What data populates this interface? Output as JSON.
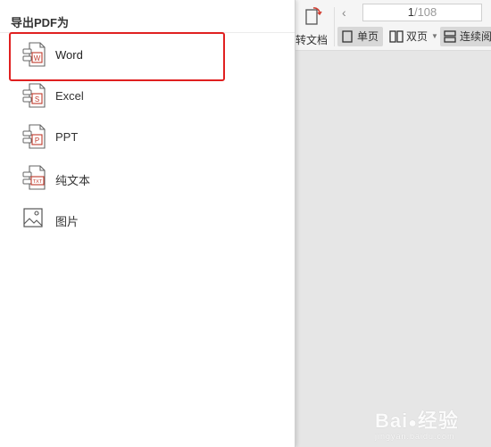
{
  "panel": {
    "title": "导出PDF为",
    "items": [
      {
        "label": "Word",
        "icon": "word-file-icon",
        "badge": "W"
      },
      {
        "label": "Excel",
        "icon": "excel-file-icon",
        "badge": "S"
      },
      {
        "label": "PPT",
        "icon": "ppt-file-icon",
        "badge": "P"
      },
      {
        "label": "纯文本",
        "icon": "txt-file-icon",
        "badge": "TXT"
      },
      {
        "label": "图片",
        "icon": "image-icon",
        "badge": ""
      }
    ],
    "selected_index": 0,
    "highlight_color": "#e02020"
  },
  "toolbar": {
    "convert_label": "转文档",
    "prev_icon": "chevron-left-icon",
    "page_current": "1",
    "page_total": "/108",
    "view_single": "单页",
    "view_double": "双页",
    "view_continuous": "连续阅"
  },
  "colors": {
    "accent": "#c0392b",
    "panel_bg": "#ffffff",
    "content_bg": "#e6e6e6"
  },
  "watermark": {
    "text": "Bai",
    "text2": "经验",
    "sub": "jingyan.baidu.com"
  }
}
